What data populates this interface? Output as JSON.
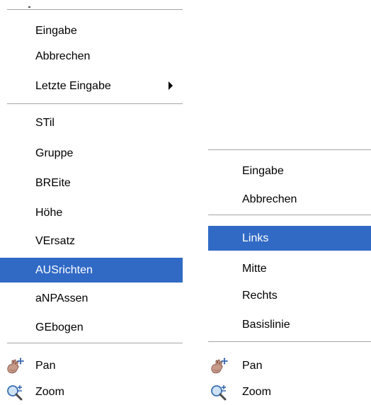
{
  "left_menu": {
    "items": [
      {
        "label": "Eingabe"
      },
      {
        "label": "Abbrechen"
      },
      {
        "label": "Letzte Eingabe"
      },
      {
        "label": "STil"
      },
      {
        "label": "Gruppe"
      },
      {
        "label": "BREite"
      },
      {
        "label": "Höhe"
      },
      {
        "label": "VErsatz"
      },
      {
        "label": "AUSrichten"
      },
      {
        "label": "aNPAssen"
      },
      {
        "label": "GEbogen"
      },
      {
        "label": "Pan",
        "icon": "pan-hand-icon"
      },
      {
        "label": "Zoom",
        "icon": "zoom-magnifier-icon"
      }
    ],
    "highlighted": "AUSrichten",
    "submenu_arrow_on": "Letzte Eingabe"
  },
  "right_menu": {
    "items": [
      {
        "label": "Eingabe"
      },
      {
        "label": "Abbrechen"
      },
      {
        "label": "Links"
      },
      {
        "label": "Mitte"
      },
      {
        "label": "Rechts"
      },
      {
        "label": "Basislinie"
      },
      {
        "label": "Pan",
        "icon": "pan-hand-icon"
      },
      {
        "label": "Zoom",
        "icon": "zoom-magnifier-icon"
      }
    ],
    "highlighted": "Links"
  },
  "colors": {
    "highlight": "#316ac5",
    "highlight_text": "#ffffff",
    "separator": "#a6a6a6"
  }
}
